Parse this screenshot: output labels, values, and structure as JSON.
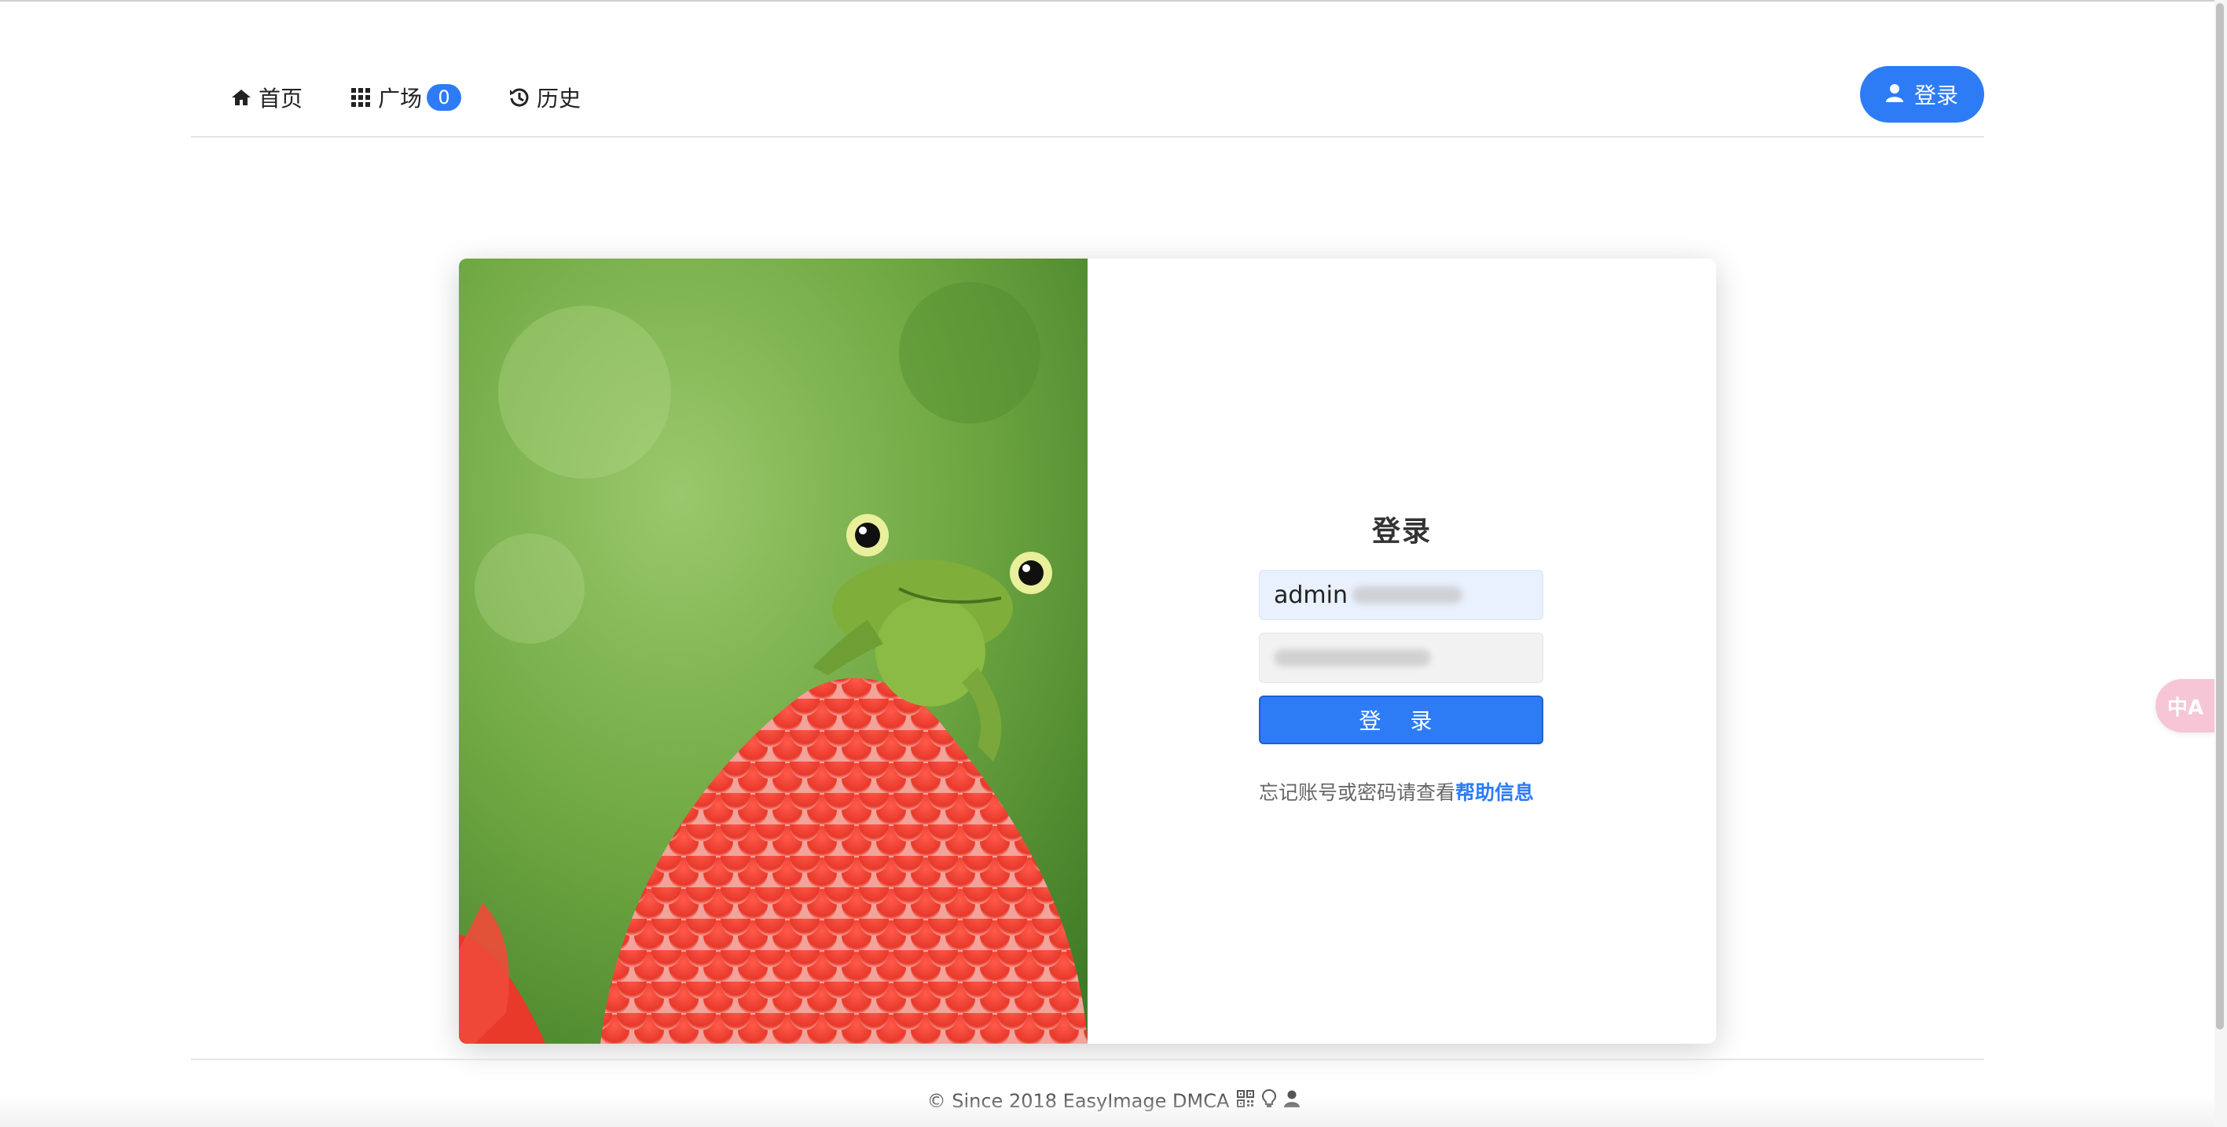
{
  "nav": {
    "home_label": "首页",
    "square_label": "广场",
    "square_badge": "0",
    "history_label": "历史",
    "login_label": "登录",
    "icons": {
      "home": "home-icon",
      "square": "grid-icon",
      "history": "history-icon",
      "login": "user-icon"
    }
  },
  "login_form": {
    "title": "登录",
    "username_value": "admin",
    "submit_label": "登 录",
    "help_text": "忘记账号或密码请查看",
    "help_link": "帮助信息"
  },
  "footer": {
    "text": "© Since 2018 EasyImage DMCA",
    "icons": [
      "qrcode-icon",
      "lightbulb-icon",
      "user-icon"
    ]
  },
  "translate_widget": {
    "label": "中A"
  },
  "colors": {
    "primary": "#2d7cf6",
    "input_user_bg": "#e9f0fe",
    "translate_bg": "#f7c6d6"
  }
}
